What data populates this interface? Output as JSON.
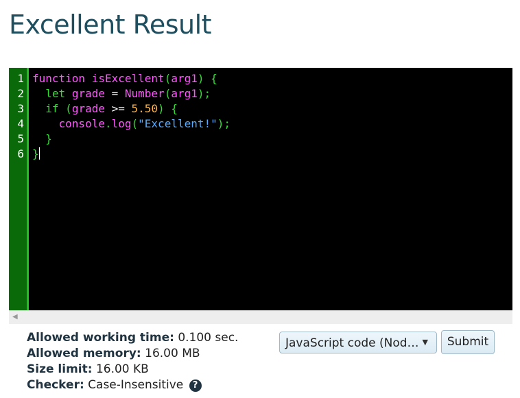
{
  "page": {
    "title": "Excellent Result"
  },
  "editor": {
    "line_numbers": [
      "1",
      "2",
      "3",
      "4",
      "5",
      "6"
    ],
    "lines": [
      [
        {
          "t": "function",
          "c": "kw"
        },
        {
          "t": " ",
          "c": "op"
        },
        {
          "t": "isExcellent",
          "c": "fn"
        },
        {
          "t": "(",
          "c": "pn"
        },
        {
          "t": "arg1",
          "c": "vr"
        },
        {
          "t": ")",
          "c": "pn"
        },
        {
          "t": " ",
          "c": "op"
        },
        {
          "t": "{",
          "c": "pn"
        }
      ],
      [
        {
          "t": "  ",
          "c": "op"
        },
        {
          "t": "let",
          "c": "pn"
        },
        {
          "t": " ",
          "c": "op"
        },
        {
          "t": "grade",
          "c": "vr"
        },
        {
          "t": " = ",
          "c": "op"
        },
        {
          "t": "Number",
          "c": "fn"
        },
        {
          "t": "(",
          "c": "pn"
        },
        {
          "t": "arg1",
          "c": "vr"
        },
        {
          "t": ");",
          "c": "pn"
        }
      ],
      [
        {
          "t": "  ",
          "c": "op"
        },
        {
          "t": "if",
          "c": "pn"
        },
        {
          "t": " ",
          "c": "op"
        },
        {
          "t": "(",
          "c": "pn"
        },
        {
          "t": "grade",
          "c": "vr"
        },
        {
          "t": " >= ",
          "c": "op"
        },
        {
          "t": "5.50",
          "c": "nm"
        },
        {
          "t": ")",
          "c": "pn"
        },
        {
          "t": " ",
          "c": "op"
        },
        {
          "t": "{",
          "c": "pn"
        }
      ],
      [
        {
          "t": "    ",
          "c": "op"
        },
        {
          "t": "console",
          "c": "vr"
        },
        {
          "t": ".",
          "c": "pn"
        },
        {
          "t": "log",
          "c": "vr"
        },
        {
          "t": "(",
          "c": "pn"
        },
        {
          "t": "\"Excellent!\"",
          "c": "st"
        },
        {
          "t": ");",
          "c": "pn"
        }
      ],
      [
        {
          "t": "  ",
          "c": "op"
        },
        {
          "t": "}",
          "c": "pn"
        }
      ],
      [
        {
          "t": "}",
          "c": "pn"
        }
      ]
    ]
  },
  "info": {
    "time_label": "Allowed working time:",
    "time_value": "0.100 sec.",
    "memory_label": "Allowed memory:",
    "memory_value": "16.00 MB",
    "size_label": "Size limit:",
    "size_value": "16.00 KB",
    "checker_label": "Checker:",
    "checker_value": "Case-Insensitive",
    "help_icon": "question-circle-icon",
    "help_glyph": "?"
  },
  "controls": {
    "language_selected": "JavaScript code (Nod…",
    "language_arrow": "▼",
    "submit_label": "Submit"
  },
  "scrollbar": {
    "left_arrow": "◀"
  }
}
